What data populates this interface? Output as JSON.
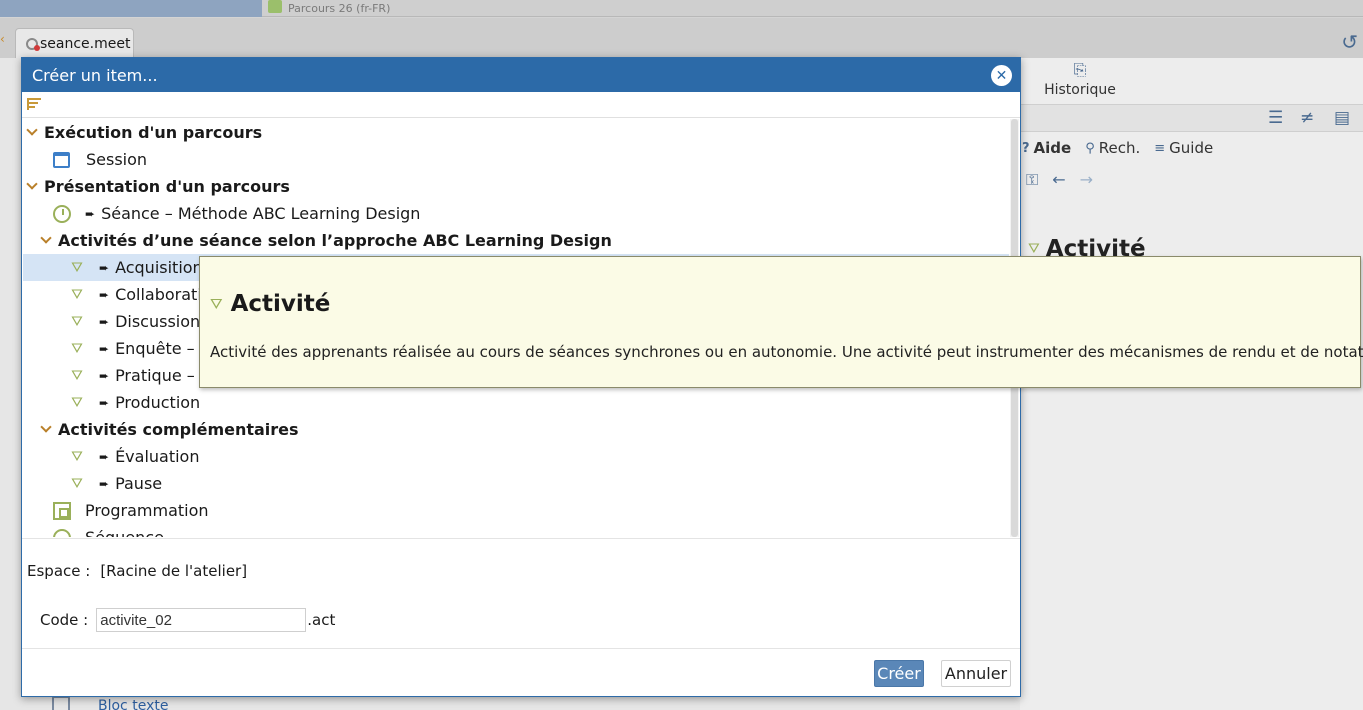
{
  "app": {
    "top_tab_label": "Parcours 26 (fr-FR)",
    "document_tab_label": "seance.meet"
  },
  "right_panel": {
    "history_label": "Historique",
    "tabs": [
      {
        "label": "Aide",
        "active": true
      },
      {
        "label": "Rech.",
        "active": false
      },
      {
        "label": "Guide",
        "active": false
      }
    ],
    "behind_title": "Activité"
  },
  "background": {
    "bottom_item_label": "Bloc texte"
  },
  "dialog": {
    "title": "Créer un item...",
    "tree": [
      {
        "type": "group",
        "label": "Exécution d'un parcours"
      },
      {
        "type": "item",
        "icon": "calendar-icon",
        "label": "Session",
        "bullet": false
      },
      {
        "type": "group",
        "label": "Présentation d'un parcours"
      },
      {
        "type": "item",
        "icon": "clock-icon",
        "label": "Séance – Méthode ABC Learning Design",
        "bullet": true
      },
      {
        "type": "group",
        "label": "Activités d’une séance selon l’approche ABC Learning Design"
      },
      {
        "type": "item",
        "icon": "activity-icon",
        "label": "Acquisition",
        "bullet": true,
        "selected": true
      },
      {
        "type": "item",
        "icon": "activity-icon",
        "label": "Collaboration",
        "bullet": true
      },
      {
        "type": "item",
        "icon": "activity-icon",
        "label": "Discussion",
        "bullet": true
      },
      {
        "type": "item",
        "icon": "activity-icon",
        "label": "Enquête –",
        "bullet": true
      },
      {
        "type": "item",
        "icon": "activity-icon",
        "label": "Pratique –",
        "bullet": true
      },
      {
        "type": "item",
        "icon": "activity-icon",
        "label": "Production",
        "bullet": true
      },
      {
        "type": "group",
        "label": "Activités complémentaires"
      },
      {
        "type": "item",
        "icon": "activity-icon",
        "label": "Évaluation",
        "bullet": true
      },
      {
        "type": "item",
        "icon": "activity-icon",
        "label": "Pause",
        "bullet": true
      },
      {
        "type": "item",
        "icon": "program-icon",
        "label": "Programmation",
        "bullet": false
      },
      {
        "type": "item",
        "icon": "sequence-icon",
        "label": "Séquence",
        "bullet": false
      }
    ],
    "espace_label": "Espace :",
    "espace_value": "[Racine de l'atelier]",
    "code_label": "Code :",
    "code_value": "activite_02",
    "code_ext": ".act",
    "create_label": "Créer",
    "cancel_label": "Annuler"
  },
  "tooltip": {
    "title": "Activité",
    "description": "Activité des apprenants réalisée au cours de séances synchrones ou en autonomie. Une activité peut instrumenter des mécanismes de rendu et de notation."
  },
  "colors": {
    "titlebar": "#2c6aa8",
    "selection": "#d5e4f5",
    "tooltip_bg": "#fbfbe6",
    "activity_icon": "#9ab05a",
    "chevron": "#b9802a"
  }
}
